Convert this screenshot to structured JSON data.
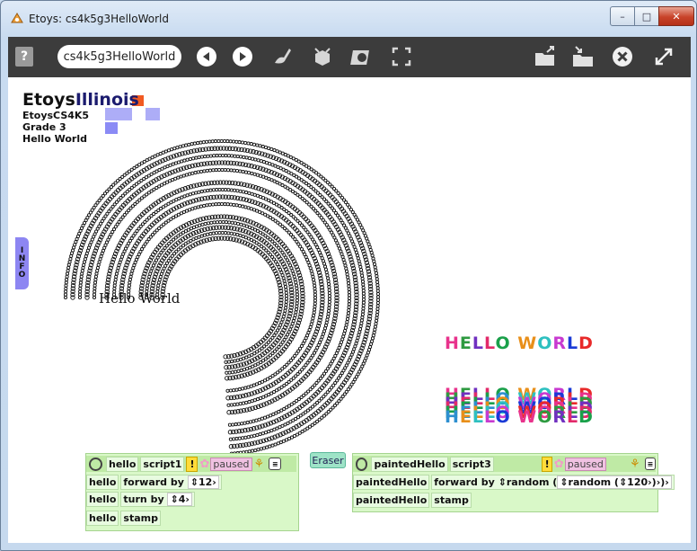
{
  "window": {
    "title": "Etoys: cs4k5g3HelloWorld",
    "minimize_glyph": "–",
    "maximize_glyph": "□",
    "close_glyph": "✕"
  },
  "toolbar": {
    "help_label": "?",
    "project_name": "cs4k5g3HelloWorld",
    "icons": [
      "help-icon",
      "back-icon",
      "forward-icon",
      "paint-icon",
      "supplies-icon",
      "globe-icon",
      "fullscreen-icon",
      "load-project-icon",
      "save-project-icon",
      "quit-icon",
      "resize-icon"
    ]
  },
  "world": {
    "logo": {
      "prefix": "Etoys",
      "highlight": "Illinois",
      "lines": [
        "EtoysCS4K5",
        "Grade 3",
        "Hello World"
      ]
    },
    "info_tab": [
      "I",
      "N",
      "F",
      "O"
    ],
    "serif_text": "Hello World",
    "colored_text": "HELLO WORLD",
    "colors": {
      "letters": [
        "#e8338c",
        "#2e9a40",
        "#7030c0",
        "#e22a6a",
        "#1aa04a",
        "#2d8fd0",
        "#e88f1a",
        "#2ec0c0",
        "#c83ad0",
        "#1a3ad6",
        "#e82a2a"
      ]
    },
    "eraser_label": "Eraser"
  },
  "scripts": {
    "hello": {
      "object": "hello",
      "script_name": "script1",
      "status": "paused",
      "rows": [
        {
          "object": "hello",
          "command": "forward by",
          "value": "12"
        },
        {
          "object": "hello",
          "command": "turn by",
          "value": "4"
        },
        {
          "object": "hello",
          "command": "stamp"
        }
      ]
    },
    "painted": {
      "object": "paintedHello",
      "script_name": "script3",
      "status": "paused",
      "rows": [
        {
          "object": "paintedHello",
          "command": "forward by",
          "arg1": "random",
          "arg2": "random",
          "value": "120"
        },
        {
          "object": "paintedHello",
          "command": "stamp"
        }
      ]
    }
  }
}
